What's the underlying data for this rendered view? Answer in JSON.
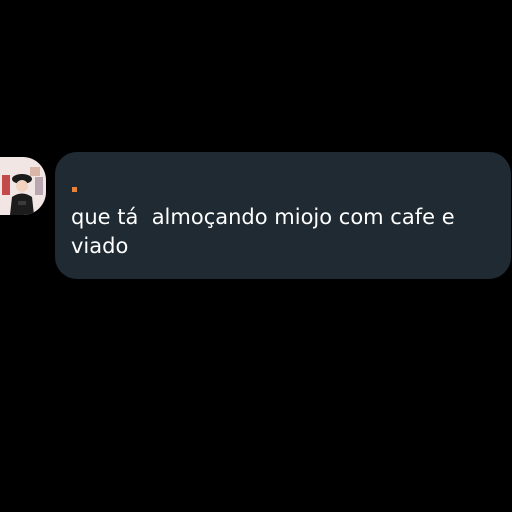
{
  "colors": {
    "background": "#000000",
    "bubble": "#1f2a32",
    "text": "#ffffff",
    "sender_dot": "#e8833a"
  },
  "avatar": {
    "icon": "user-avatar-icon"
  },
  "message": {
    "text": "que tá  almoçando miojo com cafe e viado"
  }
}
